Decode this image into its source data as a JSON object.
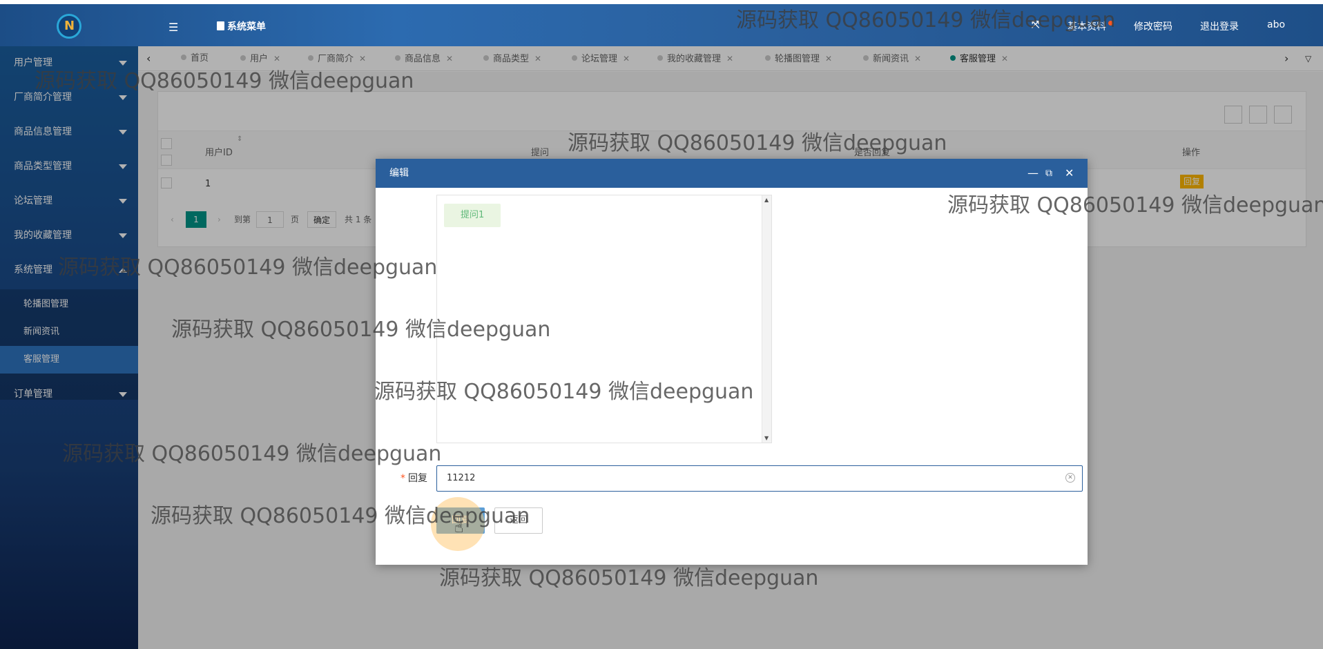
{
  "header": {
    "menu_label": "系统菜单",
    "profile": "基本资料",
    "change_password": "修改密码",
    "logout": "退出登录",
    "username": "abo"
  },
  "sidebar": {
    "items": [
      {
        "label": "用户管理"
      },
      {
        "label": "厂商简介管理"
      },
      {
        "label": "商品信息管理"
      },
      {
        "label": "商品类型管理"
      },
      {
        "label": "论坛管理"
      },
      {
        "label": "我的收藏管理"
      },
      {
        "label": "系统管理"
      },
      {
        "label": "订单管理"
      }
    ],
    "sub_items": [
      {
        "label": "轮播图管理"
      },
      {
        "label": "新闻资讯"
      },
      {
        "label": "客服管理"
      }
    ]
  },
  "tabs": [
    {
      "label": "首页"
    },
    {
      "label": "用户"
    },
    {
      "label": "厂商简介"
    },
    {
      "label": "商品信息"
    },
    {
      "label": "商品类型"
    },
    {
      "label": "论坛管理"
    },
    {
      "label": "我的收藏管理"
    },
    {
      "label": "轮播图管理"
    },
    {
      "label": "新闻资讯"
    },
    {
      "label": "客服管理"
    }
  ],
  "table": {
    "headers": [
      "用户ID",
      "提问",
      "是否回复",
      "操作"
    ],
    "rows": [
      {
        "user_id": "1",
        "action": "回复"
      }
    ]
  },
  "pager": {
    "current": "1",
    "goto_label": "到第",
    "page_input": "1",
    "page_suffix": "页",
    "confirm": "确定",
    "total": "共 1 条"
  },
  "modal": {
    "title": "编辑",
    "message": "提问1",
    "reply_label": "回复",
    "reply_value": "11212",
    "submit_label": "回复",
    "back_label": "返回"
  },
  "watermark": "源码获取 QQ86050149 微信deepguan"
}
